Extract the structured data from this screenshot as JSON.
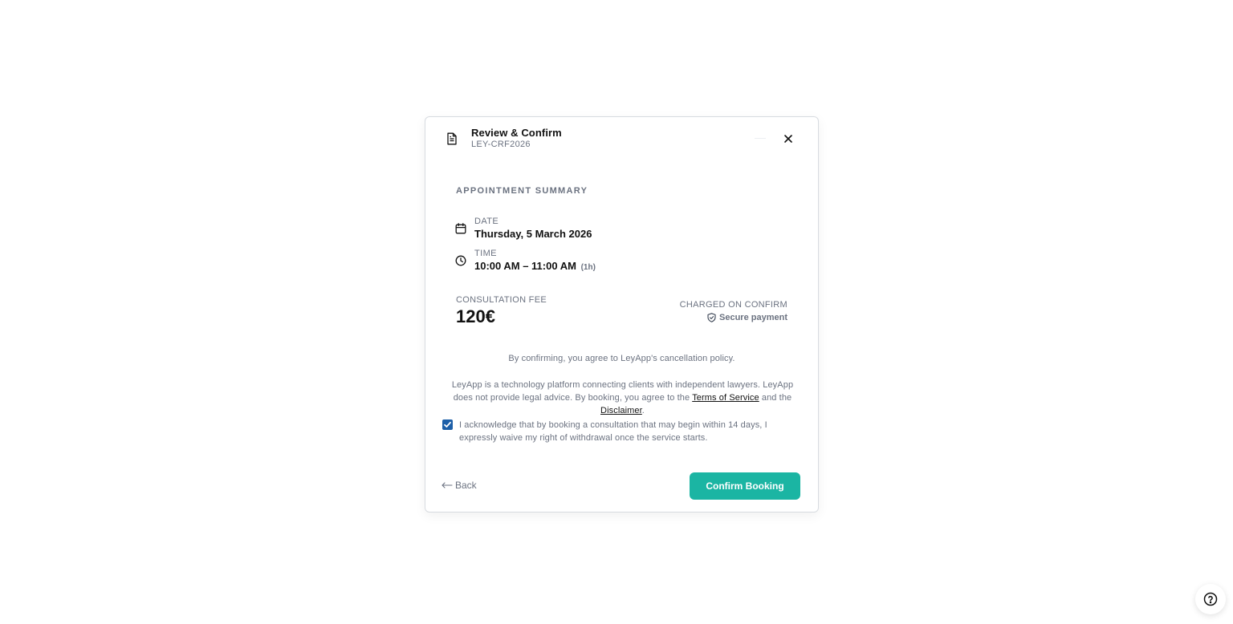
{
  "modal": {
    "title": "Review & Confirm",
    "reference": "LEY-CRF2026",
    "header_icon": "document-icon",
    "close_icon": "close-icon"
  },
  "summary": {
    "section_title": "APPOINTMENT SUMMARY",
    "date": {
      "icon": "calendar-icon",
      "label": "DATE",
      "value": "Thursday, 5 March 2026"
    },
    "time": {
      "icon": "clock-icon",
      "label": "TIME",
      "value": "10:00 AM – 11:00 AM",
      "duration": "(1h)"
    }
  },
  "fee": {
    "label": "CONSULTATION FEE",
    "amount": "120€",
    "charged_note": "CHARGED ON CONFIRM",
    "secure_label": "Secure payment",
    "secure_icon": "shield-check-icon"
  },
  "policy_text": "By confirming, you agree to LeyApp's cancellation policy.",
  "legal": {
    "text_before": "LeyApp is a technology platform connecting clients with independent lawyers. LeyApp does not provide legal advice. By booking, you agree to the ",
    "terms_link": "Terms of Service",
    "text_middle": " and the ",
    "disclaimer_link": "Disclaimer",
    "text_after": "."
  },
  "waiver": {
    "checked": true,
    "text": "I acknowledge that by booking a consultation that may begin within 14 days, I expressly waive my right of withdrawal once the service starts."
  },
  "actions": {
    "back_label": "Back",
    "back_icon": "arrow-left-icon",
    "confirm_label": "Confirm Booking"
  },
  "help": {
    "icon": "help-circle-icon"
  },
  "colors": {
    "accent": "#1bb5a3",
    "checkbox": "#1d5fa8",
    "muted_text": "#6b7280"
  }
}
